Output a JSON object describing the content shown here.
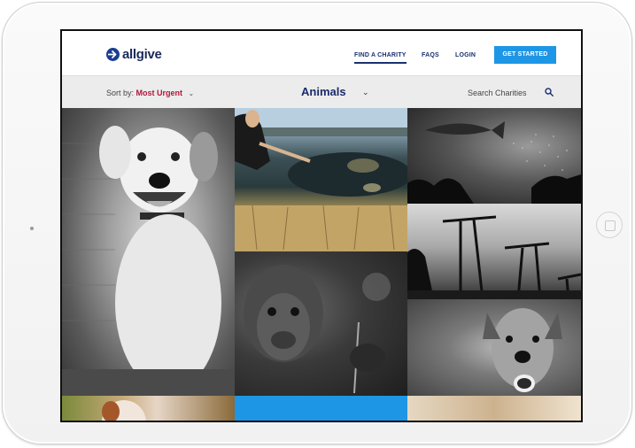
{
  "brand": {
    "name": "allgive"
  },
  "nav": {
    "find_charity": "FIND A CHARITY",
    "faqs": "FAQS",
    "login": "LOGIN",
    "get_started": "GET STARTED"
  },
  "filter": {
    "sort_label": "Sort by:",
    "sort_value": "Most Urgent",
    "category": "Animals",
    "search_placeholder": "Search Charities"
  },
  "icons": {
    "logo": "arrow-circle-icon",
    "sort_chevron": "chevron-down-icon",
    "category_chevron": "chevron-down-icon",
    "search": "search-icon"
  },
  "colors": {
    "brand_navy": "#1a2a5a",
    "accent_blue": "#1e96e6",
    "sort_value_red": "#b0173a",
    "filter_bar_bg": "#ececec"
  },
  "tiles": [
    {
      "subject": "dog"
    },
    {
      "subject": "wetland-ducks"
    },
    {
      "subject": "fish-diver"
    },
    {
      "subject": "oil-pumps"
    },
    {
      "subject": "orangutan"
    },
    {
      "subject": "dog-portrait"
    },
    {
      "subject": "puppy"
    },
    {
      "subject": "blue-tile"
    },
    {
      "subject": "fur"
    }
  ]
}
